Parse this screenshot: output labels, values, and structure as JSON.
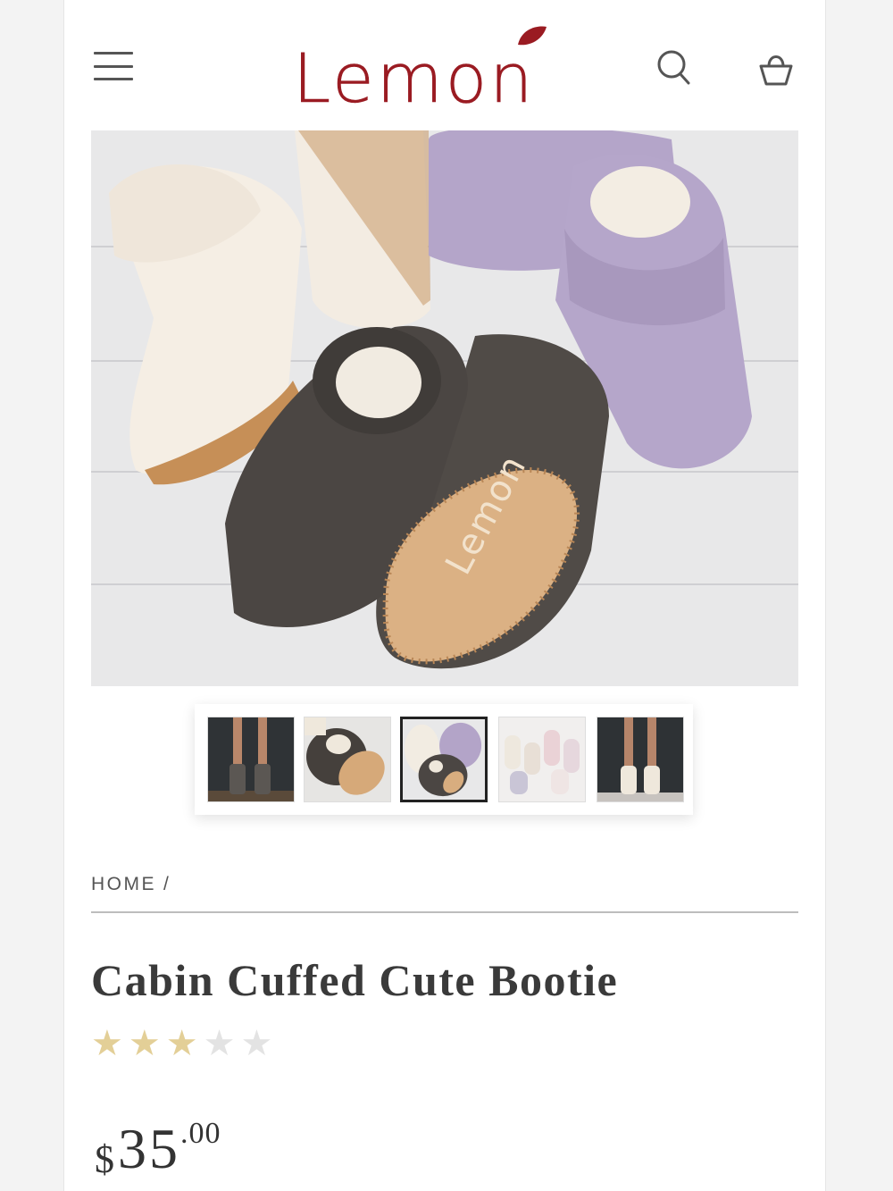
{
  "header": {
    "logo_text": "Lemon",
    "brand_color": "#9a1b22",
    "menu_icon": "hamburger-menu-icon",
    "search_icon": "search-icon",
    "bag_icon": "shopping-bag-icon"
  },
  "gallery": {
    "main_image": "knit-booties-product-photo",
    "sole_brand_text": "Lemon",
    "thumbnails": [
      {
        "name": "model-legs-charcoal-booties",
        "active": false
      },
      {
        "name": "charcoal-bootie-sole-closeup",
        "active": false
      },
      {
        "name": "three-colors-flatlay",
        "active": true
      },
      {
        "name": "pastel-booties-group",
        "active": false
      },
      {
        "name": "model-legs-cream-booties",
        "active": false
      }
    ]
  },
  "breadcrumb": {
    "home": "HOME",
    "separator": "/"
  },
  "product": {
    "title": "Cabin Cuffed Cute Bootie",
    "rating": 3,
    "rating_max": 5,
    "star_color_filled": "#e3cf97",
    "star_color_empty": "#e3e3e3",
    "price_currency": "$",
    "price_dollars": "35",
    "price_cents": ".00"
  }
}
